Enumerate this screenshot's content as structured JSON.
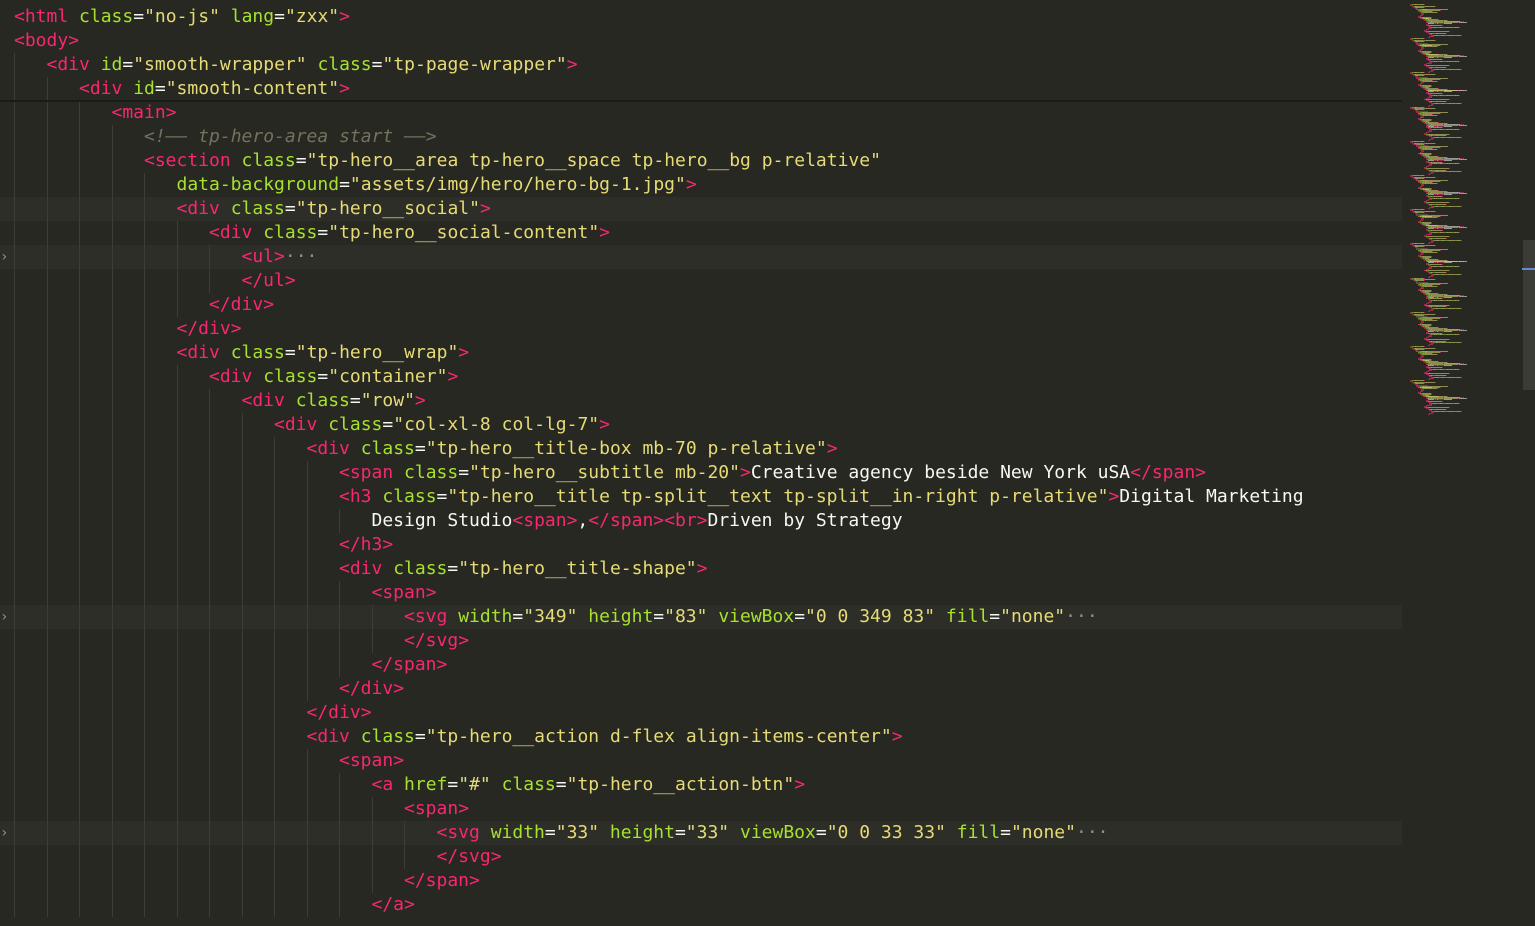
{
  "editor": {
    "language": "html",
    "lines": [
      {
        "indent": 0,
        "highlight": false,
        "fold": false,
        "parts": [
          [
            "t",
            "<html"
          ],
          [
            "a",
            " class"
          ],
          [
            "p",
            "="
          ],
          [
            "s",
            "\"no-js\""
          ],
          [
            "a",
            " lang"
          ],
          [
            "p",
            "="
          ],
          [
            "s",
            "\"zxx\""
          ],
          [
            "t",
            ">"
          ]
        ]
      },
      {
        "indent": 0,
        "highlight": false,
        "fold": false,
        "parts": [
          [
            "t",
            "<body"
          ],
          [
            "t",
            ">"
          ]
        ]
      },
      {
        "indent": 1,
        "highlight": false,
        "fold": false,
        "parts": [
          [
            "t",
            "<div"
          ],
          [
            "a",
            " id"
          ],
          [
            "p",
            "="
          ],
          [
            "s",
            "\"smooth-wrapper\""
          ],
          [
            "a",
            " class"
          ],
          [
            "p",
            "="
          ],
          [
            "s",
            "\"tp-page-wrapper\""
          ],
          [
            "t",
            ">"
          ]
        ]
      },
      {
        "indent": 2,
        "highlight": false,
        "fold": false,
        "parts": [
          [
            "t",
            "<div"
          ],
          [
            "a",
            " id"
          ],
          [
            "p",
            "="
          ],
          [
            "s",
            "\"smooth-content\""
          ],
          [
            "t",
            ">"
          ]
        ]
      },
      {
        "indent": 3,
        "highlight": false,
        "fold": false,
        "parts": [
          [
            "t",
            "<main"
          ],
          [
            "t",
            ">"
          ]
        ]
      },
      {
        "indent": 4,
        "highlight": false,
        "fold": false,
        "parts": [
          [
            "c",
            "<!—— tp-hero-area start ——>"
          ]
        ]
      },
      {
        "indent": 4,
        "highlight": false,
        "fold": false,
        "parts": [
          [
            "t",
            "<section"
          ],
          [
            "a",
            " class"
          ],
          [
            "p",
            "="
          ],
          [
            "s",
            "\"tp-hero__area tp-hero__space tp-hero__bg p-relative\""
          ]
        ]
      },
      {
        "indent": 5,
        "highlight": false,
        "fold": false,
        "parts": [
          [
            "a",
            "data-background"
          ],
          [
            "p",
            "="
          ],
          [
            "s",
            "\"assets/img/hero/hero-bg-1.jpg\""
          ],
          [
            "t",
            ">"
          ]
        ]
      },
      {
        "indent": 5,
        "highlight": true,
        "fold": false,
        "parts": [
          [
            "t",
            "<div"
          ],
          [
            "a",
            " class"
          ],
          [
            "p",
            "="
          ],
          [
            "s",
            "\"tp-hero__social\""
          ],
          [
            "t",
            ">"
          ]
        ]
      },
      {
        "indent": 6,
        "highlight": false,
        "fold": false,
        "parts": [
          [
            "t",
            "<div"
          ],
          [
            "a",
            " class"
          ],
          [
            "p",
            "="
          ],
          [
            "s",
            "\"tp-hero__social-content\""
          ],
          [
            "t",
            ">"
          ]
        ]
      },
      {
        "indent": 7,
        "highlight": true,
        "fold": true,
        "parts": [
          [
            "t",
            "<ul"
          ],
          [
            "t",
            ">"
          ],
          [
            "e",
            "···"
          ]
        ]
      },
      {
        "indent": 7,
        "highlight": false,
        "fold": false,
        "parts": [
          [
            "t",
            "</ul"
          ],
          [
            "t",
            ">"
          ]
        ]
      },
      {
        "indent": 6,
        "highlight": false,
        "fold": false,
        "parts": [
          [
            "t",
            "</div"
          ],
          [
            "t",
            ">"
          ]
        ]
      },
      {
        "indent": 5,
        "highlight": false,
        "fold": false,
        "parts": [
          [
            "t",
            "</div"
          ],
          [
            "t",
            ">"
          ]
        ]
      },
      {
        "indent": 5,
        "highlight": false,
        "fold": false,
        "parts": [
          [
            "t",
            "<div"
          ],
          [
            "a",
            " class"
          ],
          [
            "p",
            "="
          ],
          [
            "s",
            "\"tp-hero__wrap\""
          ],
          [
            "t",
            ">"
          ]
        ]
      },
      {
        "indent": 6,
        "highlight": false,
        "fold": false,
        "parts": [
          [
            "t",
            "<div"
          ],
          [
            "a",
            " class"
          ],
          [
            "p",
            "="
          ],
          [
            "s",
            "\"container\""
          ],
          [
            "t",
            ">"
          ]
        ]
      },
      {
        "indent": 7,
        "highlight": false,
        "fold": false,
        "parts": [
          [
            "t",
            "<div"
          ],
          [
            "a",
            " class"
          ],
          [
            "p",
            "="
          ],
          [
            "s",
            "\"row\""
          ],
          [
            "t",
            ">"
          ]
        ]
      },
      {
        "indent": 8,
        "highlight": false,
        "fold": false,
        "parts": [
          [
            "t",
            "<div"
          ],
          [
            "a",
            " class"
          ],
          [
            "p",
            "="
          ],
          [
            "s",
            "\"col-xl-8 col-lg-7\""
          ],
          [
            "t",
            ">"
          ]
        ]
      },
      {
        "indent": 9,
        "highlight": false,
        "fold": false,
        "parts": [
          [
            "t",
            "<div"
          ],
          [
            "a",
            " class"
          ],
          [
            "p",
            "="
          ],
          [
            "s",
            "\"tp-hero__title-box mb-70 p-relative\""
          ],
          [
            "t",
            ">"
          ]
        ]
      },
      {
        "indent": 10,
        "highlight": false,
        "fold": false,
        "parts": [
          [
            "t",
            "<span"
          ],
          [
            "a",
            " class"
          ],
          [
            "p",
            "="
          ],
          [
            "s",
            "\"tp-hero__subtitle mb-20\""
          ],
          [
            "t",
            ">"
          ],
          [
            "x",
            "Creative agency beside New York uSA"
          ],
          [
            "t",
            "</span"
          ],
          [
            "t",
            ">"
          ]
        ]
      },
      {
        "indent": 10,
        "highlight": false,
        "fold": false,
        "parts": [
          [
            "t",
            "<h3"
          ],
          [
            "a",
            " class"
          ],
          [
            "p",
            "="
          ],
          [
            "s",
            "\"tp-hero__title tp-split__text tp-split__in-right p-relative\""
          ],
          [
            "t",
            ">"
          ],
          [
            "x",
            "Digital Marketing"
          ]
        ]
      },
      {
        "indent": 11,
        "highlight": false,
        "fold": false,
        "parts": [
          [
            "x",
            "Design Studio"
          ],
          [
            "t",
            "<span"
          ],
          [
            "t",
            ">"
          ],
          [
            "x",
            ","
          ],
          [
            "t",
            "</span"
          ],
          [
            "t",
            ">"
          ],
          [
            "t",
            "<br"
          ],
          [
            "t",
            ">"
          ],
          [
            "x",
            "Driven by Strategy"
          ]
        ]
      },
      {
        "indent": 10,
        "highlight": false,
        "fold": false,
        "parts": [
          [
            "t",
            "</h3"
          ],
          [
            "t",
            ">"
          ]
        ]
      },
      {
        "indent": 10,
        "highlight": false,
        "fold": false,
        "parts": [
          [
            "t",
            "<div"
          ],
          [
            "a",
            " class"
          ],
          [
            "p",
            "="
          ],
          [
            "s",
            "\"tp-hero__title-shape\""
          ],
          [
            "t",
            ">"
          ]
        ]
      },
      {
        "indent": 11,
        "highlight": false,
        "fold": false,
        "parts": [
          [
            "t",
            "<span"
          ],
          [
            "t",
            ">"
          ]
        ]
      },
      {
        "indent": 12,
        "highlight": true,
        "fold": true,
        "parts": [
          [
            "t",
            "<svg"
          ],
          [
            "a",
            " width"
          ],
          [
            "p",
            "="
          ],
          [
            "s",
            "\"349\""
          ],
          [
            "a",
            " height"
          ],
          [
            "p",
            "="
          ],
          [
            "s",
            "\"83\""
          ],
          [
            "a",
            " viewBox"
          ],
          [
            "p",
            "="
          ],
          [
            "s",
            "\"0 0 349 83\""
          ],
          [
            "a",
            " fill"
          ],
          [
            "p",
            "="
          ],
          [
            "s",
            "\"none\""
          ],
          [
            "e",
            "···"
          ]
        ]
      },
      {
        "indent": 12,
        "highlight": false,
        "fold": false,
        "parts": [
          [
            "t",
            "</svg"
          ],
          [
            "t",
            ">"
          ]
        ]
      },
      {
        "indent": 11,
        "highlight": false,
        "fold": false,
        "parts": [
          [
            "t",
            "</span"
          ],
          [
            "t",
            ">"
          ]
        ]
      },
      {
        "indent": 10,
        "highlight": false,
        "fold": false,
        "parts": [
          [
            "t",
            "</div"
          ],
          [
            "t",
            ">"
          ]
        ]
      },
      {
        "indent": 9,
        "highlight": false,
        "fold": false,
        "parts": [
          [
            "t",
            "</div"
          ],
          [
            "t",
            ">"
          ]
        ]
      },
      {
        "indent": 9,
        "highlight": false,
        "fold": false,
        "parts": [
          [
            "t",
            "<div"
          ],
          [
            "a",
            " class"
          ],
          [
            "p",
            "="
          ],
          [
            "s",
            "\"tp-hero__action d-flex align-items-center\""
          ],
          [
            "t",
            ">"
          ]
        ]
      },
      {
        "indent": 10,
        "highlight": false,
        "fold": false,
        "parts": [
          [
            "t",
            "<span"
          ],
          [
            "t",
            ">"
          ]
        ]
      },
      {
        "indent": 11,
        "highlight": false,
        "fold": false,
        "parts": [
          [
            "t",
            "<a"
          ],
          [
            "a",
            " href"
          ],
          [
            "p",
            "="
          ],
          [
            "s",
            "\"#\""
          ],
          [
            "a",
            " class"
          ],
          [
            "p",
            "="
          ],
          [
            "s",
            "\"tp-hero__action-btn\""
          ],
          [
            "t",
            ">"
          ]
        ]
      },
      {
        "indent": 12,
        "highlight": false,
        "fold": false,
        "parts": [
          [
            "t",
            "<span"
          ],
          [
            "t",
            ">"
          ]
        ]
      },
      {
        "indent": 13,
        "highlight": true,
        "fold": true,
        "parts": [
          [
            "t",
            "<svg"
          ],
          [
            "a",
            " width"
          ],
          [
            "p",
            "="
          ],
          [
            "s",
            "\"33\""
          ],
          [
            "a",
            " height"
          ],
          [
            "p",
            "="
          ],
          [
            "s",
            "\"33\""
          ],
          [
            "a",
            " viewBox"
          ],
          [
            "p",
            "="
          ],
          [
            "s",
            "\"0 0 33 33\""
          ],
          [
            "a",
            " fill"
          ],
          [
            "p",
            "="
          ],
          [
            "s",
            "\"none\""
          ],
          [
            "e",
            "···"
          ]
        ]
      },
      {
        "indent": 13,
        "highlight": false,
        "fold": false,
        "parts": [
          [
            "t",
            "</svg"
          ],
          [
            "t",
            ">"
          ]
        ]
      },
      {
        "indent": 12,
        "highlight": false,
        "fold": false,
        "parts": [
          [
            "t",
            "</span"
          ],
          [
            "t",
            ">"
          ]
        ]
      },
      {
        "indent": 11,
        "highlight": false,
        "fold": false,
        "parts": [
          [
            "t",
            "</a"
          ],
          [
            "t",
            ">"
          ]
        ]
      }
    ]
  },
  "colors": {
    "background": "#272822",
    "tag": "#f92672",
    "attribute": "#a6e22e",
    "string": "#e6db74",
    "text": "#f8f8f2",
    "comment": "#75715e"
  },
  "icons": {
    "fold": "chevron-right-icon"
  }
}
